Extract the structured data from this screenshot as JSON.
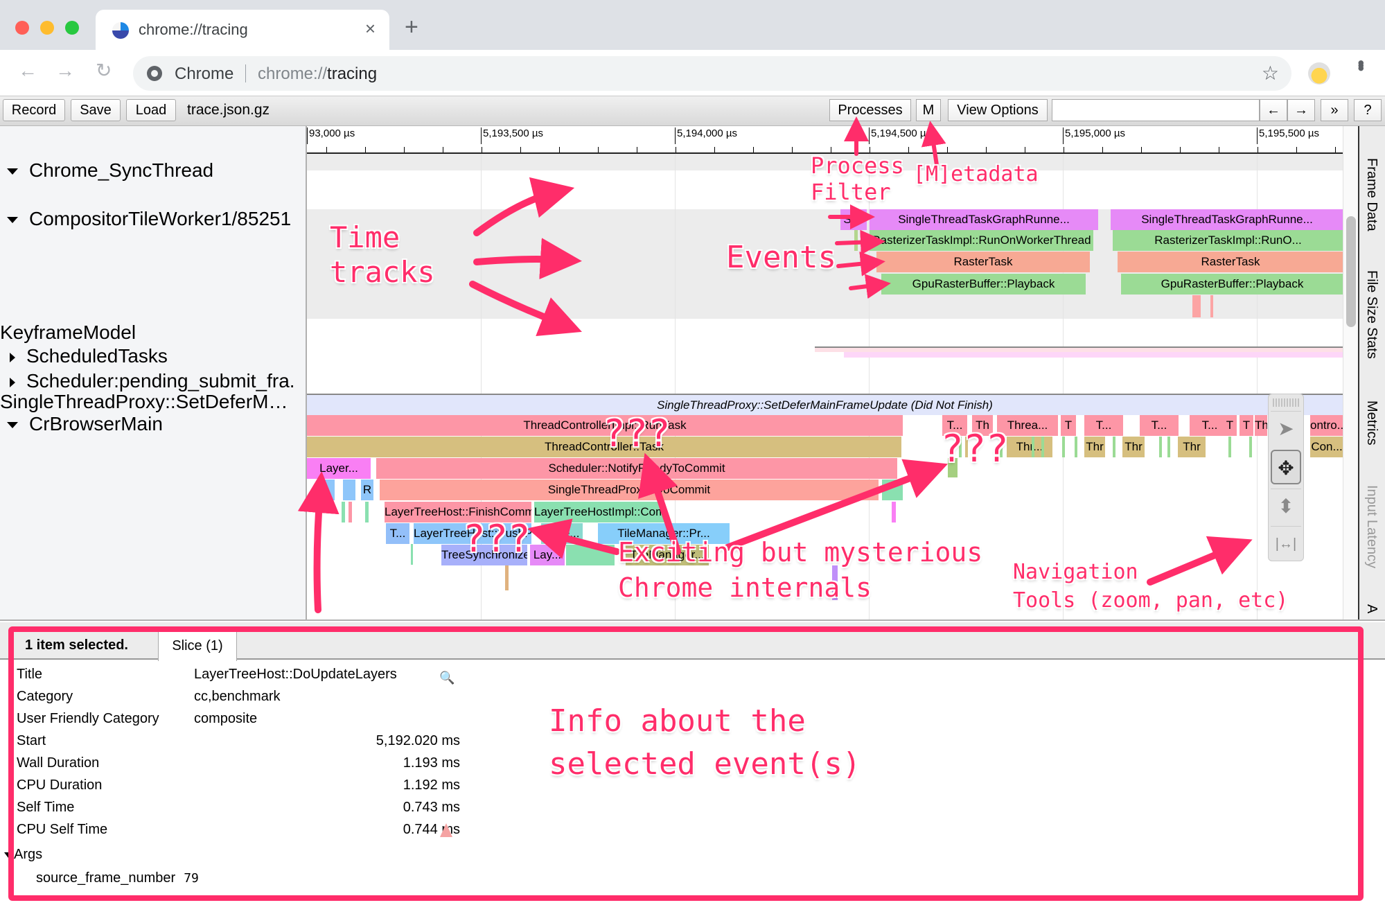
{
  "browser": {
    "tab_title": "chrome://tracing",
    "omnibox_site": "Chrome",
    "omnibox_url_prefix": "chrome://",
    "omnibox_url_path": "tracing",
    "icons": {
      "back": "arrow-left-icon",
      "forward": "arrow-right-icon",
      "reload": "reload-icon",
      "bookmark": "star-icon",
      "menu": "kebab-menu-icon",
      "profile": "avatar-cat"
    },
    "traffic_colors": [
      "#ff5f57",
      "#febc2e",
      "#28c840"
    ]
  },
  "trace_toolbar": {
    "record_label": "Record",
    "save_label": "Save",
    "load_label": "Load",
    "file_name": "trace.json.gz",
    "processes_label": "Processes",
    "metadata_label": "M",
    "view_options_label": "View Options",
    "search_value": "",
    "prev_label": "←",
    "next_label": "→",
    "more_label": "»",
    "help_label": "?"
  },
  "ruler": {
    "ticks": [
      "93,000 µs",
      "5,193,500 µs",
      "5,194,000 µs",
      "5,194,500 µs",
      "5,195,000 µs",
      "5,195,500 µs"
    ]
  },
  "tracks": {
    "labels": [
      {
        "text": "Chrome_SyncThread",
        "expander": "down"
      },
      {
        "text": "CompositorTileWorker1/85251",
        "expander": "down"
      },
      {
        "text": "KeyframeModel",
        "expander": "none"
      },
      {
        "text": "ScheduledTasks",
        "expander": "right"
      },
      {
        "text": "Scheduler:pending_submit_fra.",
        "expander": "right"
      },
      {
        "text": "SingleThreadProxy::SetDeferM…",
        "expander": "none"
      },
      {
        "text": "CrBrowserMain",
        "expander": "down"
      }
    ]
  },
  "slices": {
    "worker": [
      {
        "label": "Si...",
        "color": "#e68af7"
      },
      {
        "label": "SingleThreadTaskGraphRunne...",
        "color": "#e68af7"
      },
      {
        "label": "SingleThreadTaskGraphRunne...",
        "color": "#e68af7"
      },
      {
        "label": "RasterizerTaskImpl::RunOnWorkerThread",
        "color": "#9bdb95"
      },
      {
        "label": "RasterizerTaskImpl::RunO...",
        "color": "#9bdb95"
      },
      {
        "label": "RasterTask",
        "color": "#f7a994"
      },
      {
        "label": "RasterTask",
        "color": "#f7a994"
      },
      {
        "label": "GpuRasterBuffer::Playback",
        "color": "#9bdb95"
      },
      {
        "label": "GpuRasterBuffer::Playback",
        "color": "#9bdb95"
      }
    ],
    "main": [
      {
        "label": "SingleThreadProxy::SetDeferMainFrameUpdate (Did Not Finish)",
        "color": "#e1e6fb"
      },
      {
        "label": "ThreadControllerImpl::RunTask",
        "color": "#fd96a6"
      },
      {
        "label": "ThreadController::Task",
        "color": "#d6bf7f"
      },
      {
        "label": "Layer...",
        "color": "#f97ff4"
      },
      {
        "label": "Scheduler::NotifyReadyToCommit",
        "color": "#fd96a6"
      },
      {
        "label": "R",
        "color": "#8ec6fa"
      },
      {
        "label": "SingleThreadProxy::DoCommit",
        "color": "#fda39c"
      },
      {
        "label": "LayerTreeHost::FinishCommitOnImplThread",
        "color": "#fd96a6"
      },
      {
        "label": "LayerTreeHostImpl::CommitComplete",
        "color": "#8ae0b0"
      },
      {
        "label": "T...",
        "color": "#93bff9"
      },
      {
        "label": "LayerTreeHost::PushProperties",
        "color": "#8ec6fa"
      },
      {
        "label": "Laye...",
        "color": "#8ad9cf"
      },
      {
        "label": "TileManager::Pr...",
        "color": "#87cefa"
      },
      {
        "label": "TreeSynchronize...",
        "color": "#a7b0fa"
      },
      {
        "label": "Lay...",
        "color": "#e68af7"
      },
      {
        "label": "TileManager...",
        "color": "#bfbd79"
      }
    ],
    "main_right_row1": [
      "T...",
      "Th",
      "Threa...",
      "T",
      "T...",
      "T...",
      "T...",
      "T",
      "T",
      "Th",
      "ontro..."
    ],
    "main_right_row2": [
      "Thr...",
      "Thr",
      "Thr",
      "Thr",
      "Con..."
    ]
  },
  "side_tabs": [
    "Frame Data",
    "File Size Stats",
    "Metrics",
    "Input Latency",
    "A"
  ],
  "nav_tools": [
    {
      "name": "select",
      "glyph": "➤",
      "active": false
    },
    {
      "name": "pan",
      "glyph": "✥",
      "active": true
    },
    {
      "name": "zoom",
      "glyph": "⬍",
      "active": false
    },
    {
      "name": "timing",
      "glyph": "|↔|",
      "active": false
    }
  ],
  "analysis": {
    "summary": "1 item selected.",
    "tab_label": "Slice (1)",
    "rows": [
      {
        "key": "Title",
        "value": "LayerTreeHost::DoUpdateLayers",
        "align": "left"
      },
      {
        "key": "Category",
        "value": "cc,benchmark",
        "align": "left"
      },
      {
        "key": "User Friendly Category",
        "value": "composite",
        "align": "left"
      },
      {
        "key": "Start",
        "value": "5,192.020 ms",
        "align": "right"
      },
      {
        "key": "Wall Duration",
        "value": "1.193 ms",
        "align": "right"
      },
      {
        "key": "CPU Duration",
        "value": "1.192 ms",
        "align": "right"
      },
      {
        "key": "Self Time",
        "value": "0.743 ms",
        "align": "right"
      },
      {
        "key": "CPU Self Time",
        "value": "0.744 ms",
        "align": "right"
      }
    ],
    "args_label": "Args",
    "arg_key": "source_frame_number",
    "arg_value": "79"
  },
  "annotations": {
    "time_tracks": "Time\ntracks",
    "process_filter": "Process\nFilter",
    "metadata": "[M]etadata",
    "events": "Events",
    "qqq": "???",
    "mysterious": "Exciting but mysterious\nChrome internals",
    "navigation": "Navigation\nTools (zoom, pan, etc)",
    "info": "Info about the\nselected event(s)",
    "accent_color": "#ff2d6a"
  }
}
